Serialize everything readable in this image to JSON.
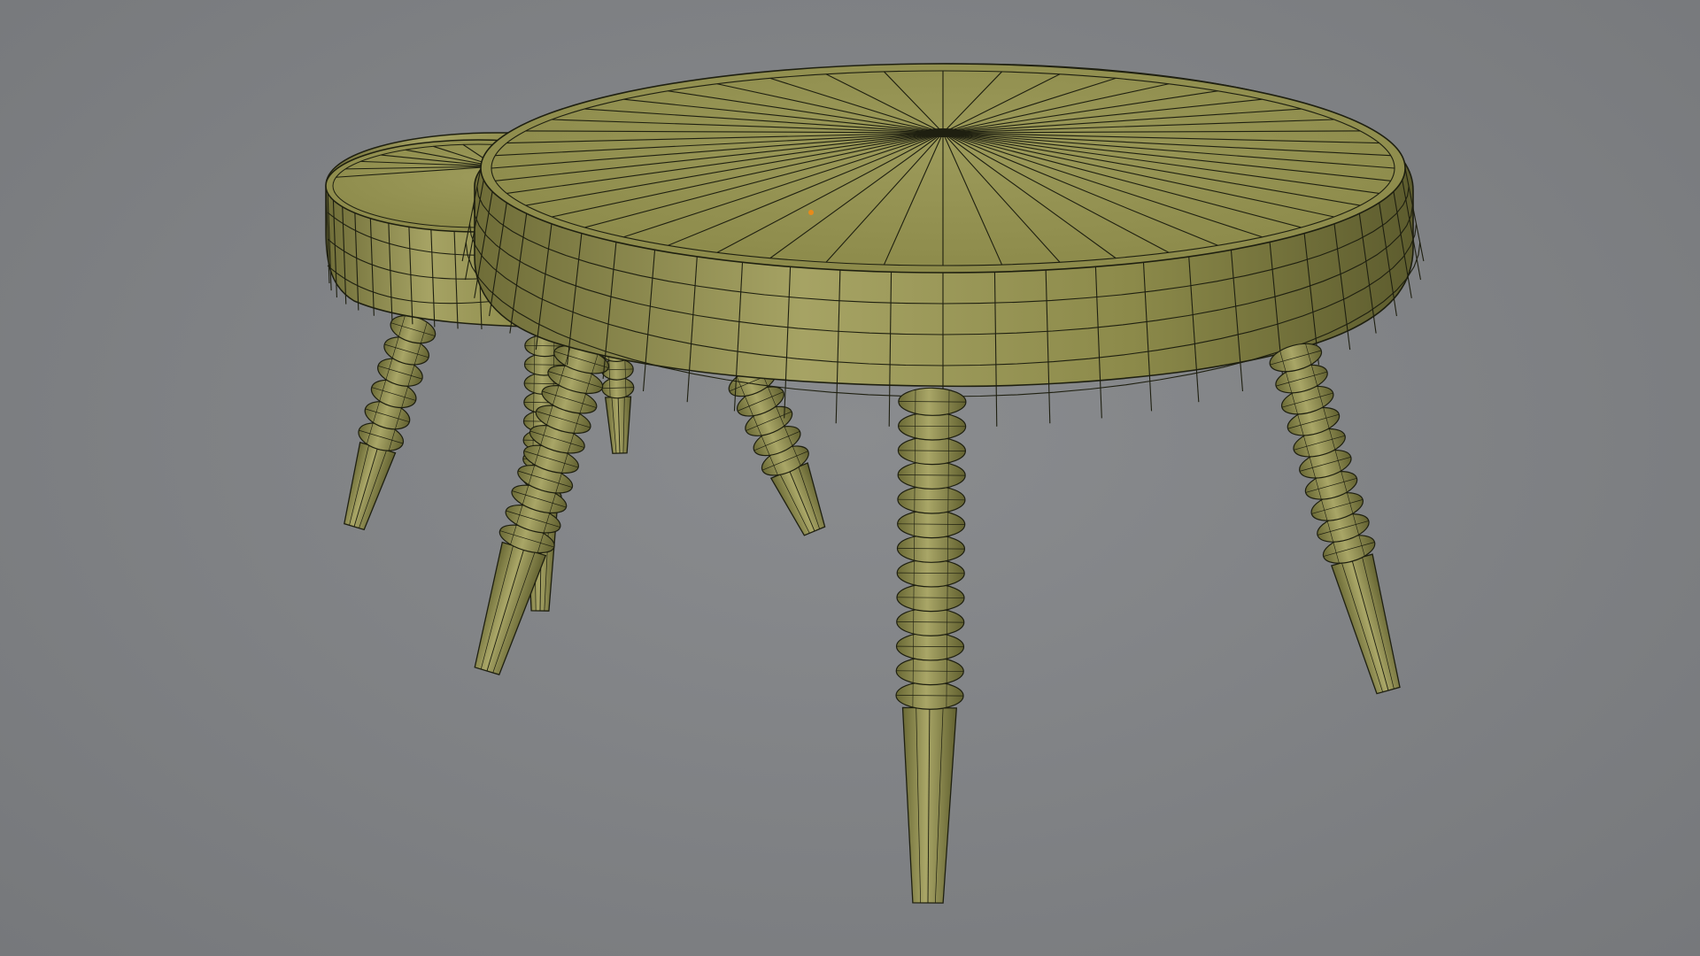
{
  "viewport": {
    "background_color": "#7f8184",
    "mesh_color": "#8f8d4d",
    "mesh_light": "#a5a261",
    "mesh_dark": "#6b6a36",
    "wire_color": "#1e1f10",
    "origin_color": "#e88a1a"
  },
  "scene": {
    "objects": [
      {
        "name": "large-side-table",
        "shape": "round-top",
        "legs": 4,
        "leg_style": "bead-turned-splayed"
      },
      {
        "name": "small-side-table",
        "shape": "round-top",
        "legs": 4,
        "leg_style": "bead-turned-splayed"
      }
    ],
    "display_mode": "solid-with-wireframe",
    "selected_object_origin": "orange-dot"
  }
}
